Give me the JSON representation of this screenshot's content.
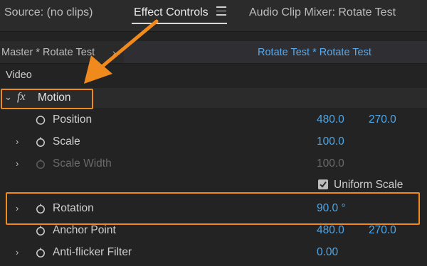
{
  "tabs": {
    "source": "Source: (no clips)",
    "effect_controls": "Effect Controls",
    "audio_mixer": "Audio Clip Mixer: Rotate Test"
  },
  "clip": {
    "master": "Master * Rotate Test",
    "sequence": "Rotate Test * Rotate Test"
  },
  "section": "Video",
  "motion": {
    "fx": "fx",
    "label": "Motion"
  },
  "properties": [
    {
      "label": "Position",
      "v1": "480.0",
      "v2": "270.0"
    },
    {
      "label": "Scale",
      "v1": "100.0"
    },
    {
      "label": "Scale Width",
      "v1": "100.0"
    },
    {
      "label": "Uniform Scale",
      "checked": true
    },
    {
      "label": "Rotation",
      "v1": "90.0 °"
    },
    {
      "label": "Anchor Point",
      "v1": "480.0",
      "v2": "270.0"
    },
    {
      "label": "Anti-flicker Filter",
      "v1": "0.00"
    }
  ],
  "colors": {
    "accent_value": "#4ea7e8",
    "highlight": "#f08a1c",
    "panel_bg": "#232323"
  },
  "icons": [
    "menu-icon",
    "twirl-arrow-icon",
    "stopwatch-icon",
    "fx-icon",
    "checkmark-icon",
    "annotation-arrow-icon"
  ]
}
